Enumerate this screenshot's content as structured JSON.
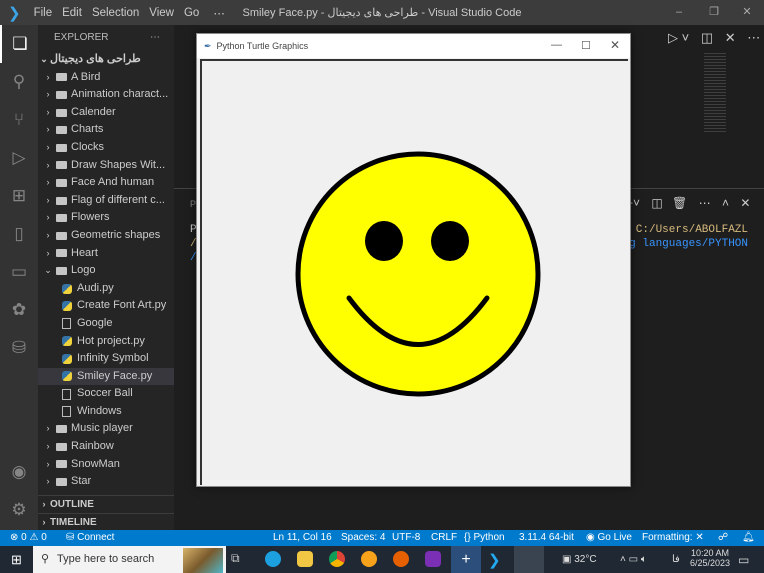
{
  "titlebar": {
    "menu": [
      "File",
      "Edit",
      "Selection",
      "View",
      "Go",
      "⋯"
    ],
    "title": "Smiley Face.py - طراحی های دیجیتال - Visual Studio Code"
  },
  "sidebar": {
    "header": "EXPLORER",
    "more": "⋯",
    "root": "طراحی های دیجیتال",
    "items": [
      {
        "label": "A Bird",
        "type": "folder",
        "open": false,
        "depth": 1
      },
      {
        "label": "Animation charact...",
        "type": "folder",
        "open": false,
        "depth": 1
      },
      {
        "label": "Calender",
        "type": "folder",
        "open": false,
        "depth": 1
      },
      {
        "label": "Charts",
        "type": "folder",
        "open": false,
        "depth": 1
      },
      {
        "label": "Clocks",
        "type": "folder",
        "open": false,
        "depth": 1
      },
      {
        "label": "Draw Shapes Wit...",
        "type": "folder",
        "open": false,
        "depth": 1
      },
      {
        "label": "Face And human",
        "type": "folder",
        "open": false,
        "depth": 1
      },
      {
        "label": "Flag of different c...",
        "type": "folder",
        "open": false,
        "depth": 1
      },
      {
        "label": "Flowers",
        "type": "folder",
        "open": false,
        "depth": 1
      },
      {
        "label": "Geometric shapes",
        "type": "folder",
        "open": false,
        "depth": 1
      },
      {
        "label": "Heart",
        "type": "folder",
        "open": false,
        "depth": 1
      },
      {
        "label": "Logo",
        "type": "folder",
        "open": true,
        "depth": 1
      },
      {
        "label": "Audi.py",
        "type": "py",
        "depth": 2
      },
      {
        "label": "Create Font Art.py",
        "type": "py",
        "depth": 2
      },
      {
        "label": "Google",
        "type": "file",
        "depth": 2
      },
      {
        "label": "Hot project.py",
        "type": "py",
        "depth": 2
      },
      {
        "label": "Infinity Symbol",
        "type": "py",
        "depth": 2
      },
      {
        "label": "Smiley Face.py",
        "type": "py",
        "depth": 2,
        "selected": true
      },
      {
        "label": "Soccer Ball",
        "type": "file",
        "depth": 2
      },
      {
        "label": "Windows",
        "type": "file",
        "depth": 2
      },
      {
        "label": "Music player",
        "type": "folder",
        "open": false,
        "depth": 1
      },
      {
        "label": "Rainbow",
        "type": "folder",
        "open": false,
        "depth": 1
      },
      {
        "label": "SnowMan",
        "type": "folder",
        "open": false,
        "depth": 1
      },
      {
        "label": "Star",
        "type": "folder",
        "open": false,
        "depth": 1
      }
    ],
    "outline": "OUTLINE",
    "timeline": "TIMELINE"
  },
  "panel": {
    "tab": "P",
    "lines": [
      {
        "left": "P",
        "right": "C:/Users/ABOLFAZL"
      },
      {
        "left": "/",
        "right": "g languages/PYTHON"
      },
      {
        "left": "/",
        "right": ""
      }
    ]
  },
  "turtle": {
    "title": "Python Turtle Graphics",
    "face_color": "#ffff00",
    "outline_color": "#000000"
  },
  "status": {
    "errors": "0",
    "warnings": "0",
    "connect": "Connect",
    "position": "Ln 11, Col 16",
    "spaces": "Spaces: 4",
    "encoding": "UTF-8",
    "eol": "CRLF",
    "language": "Python",
    "interpreter": "3.11.4 64-bit",
    "golive": "Go Live",
    "formatting": "Formatting: ✕"
  },
  "taskbar": {
    "search_placeholder": "Type here to search",
    "weather": "32°C",
    "lang": "فا",
    "time": "10:20 AM",
    "date": "6/25/2023"
  },
  "colors": {
    "accent": "#007acc"
  }
}
